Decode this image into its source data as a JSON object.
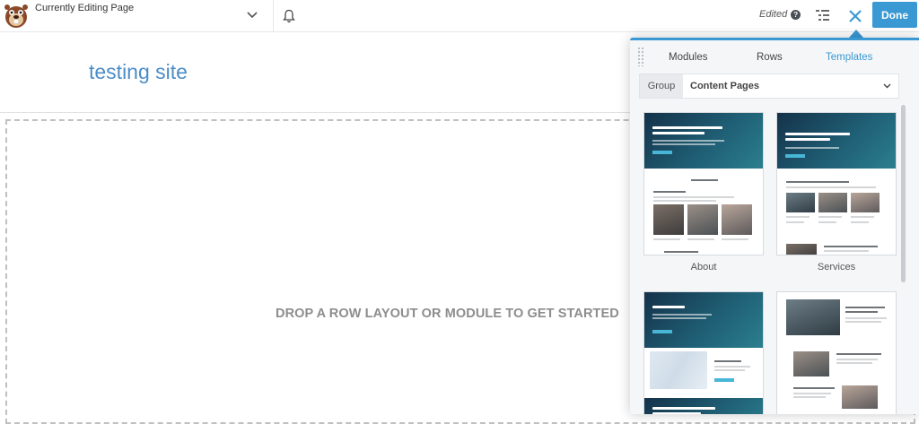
{
  "topbar": {
    "page_title": "Currently Editing Page",
    "edited_label": "Edited",
    "help_glyph": "?",
    "done_label": "Done",
    "icons": [
      "beaver-logo",
      "chevron-down-icon",
      "bell-icon",
      "help-icon",
      "outline-list-icon",
      "close-icon"
    ]
  },
  "site": {
    "title": "testing site",
    "drop_text": "DROP A ROW LAYOUT OR MODULE TO GET STARTED"
  },
  "panel": {
    "tabs": [
      {
        "label": "Modules",
        "active": false
      },
      {
        "label": "Rows",
        "active": false
      },
      {
        "label": "Templates",
        "active": true
      }
    ],
    "group_label": "Group",
    "group_value": "Content Pages",
    "templates": [
      {
        "label": "About"
      },
      {
        "label": "Services"
      },
      {
        "label": ""
      },
      {
        "label": ""
      }
    ]
  },
  "colors": {
    "accent": "#3a99d3",
    "site_title": "#4b8dc7",
    "drop_text": "#8d8d8d",
    "panel_bg": "#f5f6f7"
  }
}
